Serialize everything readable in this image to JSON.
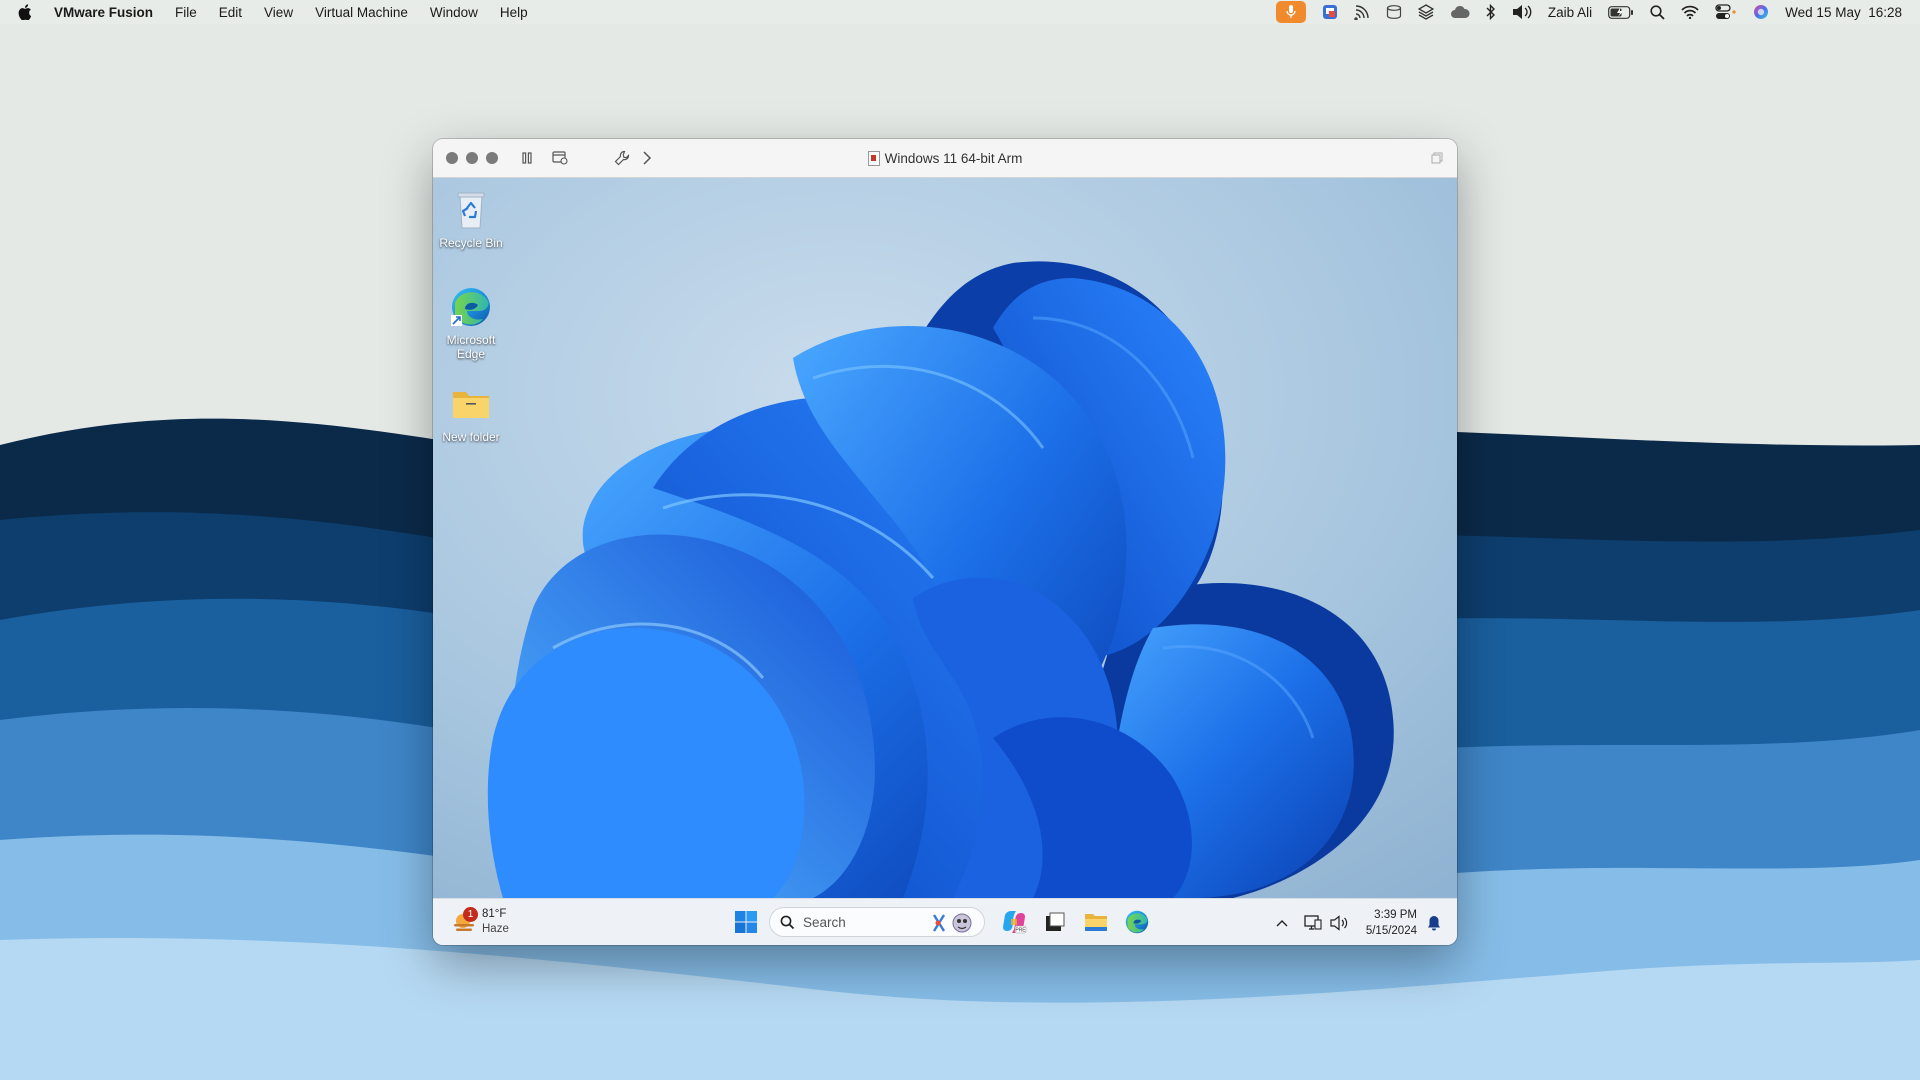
{
  "menubar": {
    "app_name": "VMware Fusion",
    "menus": [
      "File",
      "Edit",
      "View",
      "Virtual Machine",
      "Window",
      "Help"
    ],
    "user": "Zaib Ali",
    "datetime": "Wed 15 May  16:28",
    "mic_color": "#f08a2c"
  },
  "vm_window": {
    "title": "Windows 11 64-bit Arm"
  },
  "desktop": {
    "icons": [
      {
        "label": "Recycle Bin",
        "icon": "recycle-bin-icon"
      },
      {
        "label": "Microsoft Edge",
        "icon": "edge-icon"
      },
      {
        "label": "New folder",
        "icon": "folder-icon"
      }
    ]
  },
  "taskbar": {
    "weather_badge": "1",
    "temperature": "81°F",
    "condition": "Haze",
    "search_placeholder": "Search",
    "time": "3:39 PM",
    "date": "5/15/2024"
  }
}
